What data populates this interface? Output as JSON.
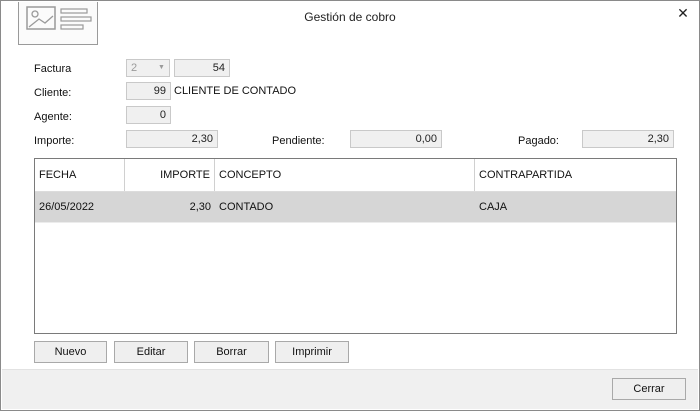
{
  "window": {
    "title": "Gestión de cobro",
    "close_icon": "✕"
  },
  "form": {
    "factura_label": "Factura",
    "factura_serie": "2",
    "factura_numero": "54",
    "cliente_label": "Cliente:",
    "cliente_codigo": "99",
    "cliente_nombre": "CLIENTE DE CONTADO",
    "agente_label": "Agente:",
    "agente_valor": "0",
    "importe_label": "Importe:",
    "importe_valor": "2,30",
    "pendiente_label": "Pendiente:",
    "pendiente_valor": "0,00",
    "pagado_label": "Pagado:",
    "pagado_valor": "2,30"
  },
  "grid": {
    "columns": [
      "FECHA",
      "IMPORTE",
      "CONCEPTO",
      "CONTRAPARTIDA"
    ],
    "rows": [
      {
        "fecha": "26/05/2022",
        "importe": "2,30",
        "concepto": "CONTADO",
        "contrapartida": "CAJA"
      }
    ]
  },
  "actions": {
    "nuevo": "Nuevo",
    "editar": "Editar",
    "borrar": "Borrar",
    "imprimir": "Imprimir"
  },
  "footer": {
    "cerrar": "Cerrar"
  }
}
